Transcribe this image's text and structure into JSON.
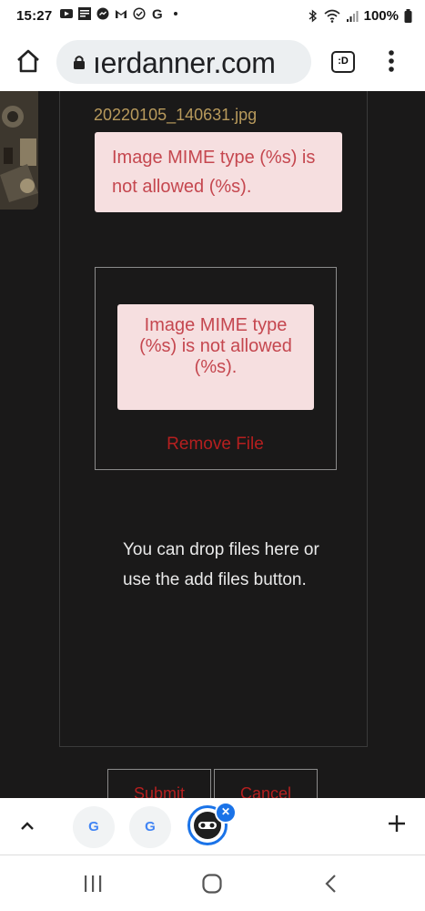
{
  "status_bar": {
    "time": "15:27",
    "battery": "100%",
    "left_icons": [
      "youtube-icon",
      "news-icon",
      "messenger-icon",
      "gmail-icon",
      "check-circle-icon",
      "google-icon",
      "dot-icon"
    ],
    "right_icons": [
      "bluetooth-icon",
      "wifi-icon",
      "signal-icon",
      "battery-icon"
    ]
  },
  "browser": {
    "url": "ıerdanner.com",
    "tabs_label": ":D"
  },
  "page": {
    "filename": "20220105_140631.jpg",
    "error_message": "Image MIME type (%s) is not allowed (%s).",
    "preview_error_message": "Image MIME type (%s) is not allowed (%s).",
    "remove_file_label": "Remove File",
    "drop_text": "You can drop files here or use the add files button.",
    "submit_label": "Submit",
    "cancel_label": "Cancel"
  },
  "tab_strip": {
    "tabs": [
      {
        "label": "G"
      },
      {
        "label": "G"
      }
    ]
  },
  "colors": {
    "background": "#1a1919",
    "error_bg": "#f6dfe0",
    "error_text": "#c5474f",
    "link_red": "#b51f1f",
    "filename": "#b89a5c",
    "accent_blue": "#1a73e8"
  }
}
